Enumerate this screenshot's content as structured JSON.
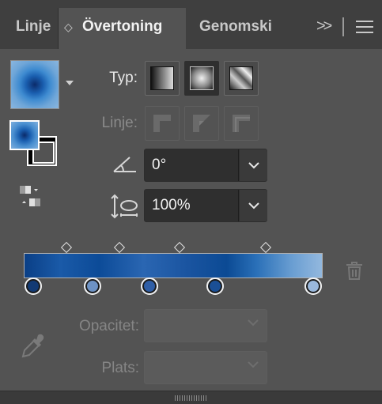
{
  "tabs": {
    "linje": "Linje",
    "overtoning": "Övertoning",
    "genomskinlighet": "Genomski",
    "more_icon": "double-chevron-right-icon",
    "menu_icon": "hamburger-menu-icon"
  },
  "labels": {
    "typ": "Typ:",
    "linje": "Linje:",
    "opacitet": "Opacitet:",
    "plats": "Plats:"
  },
  "angle": {
    "value": "0°"
  },
  "aspect": {
    "value": "100%"
  },
  "gradient": {
    "stops": [
      {
        "color": "#123a74",
        "location": 0.03
      },
      {
        "color": "#6d92c4",
        "location": 0.23
      },
      {
        "color": "#2f5ea6",
        "location": 0.42
      },
      {
        "color": "#1a4f96",
        "location": 0.64
      },
      {
        "color": "#9ab8dc",
        "location": 0.97
      }
    ],
    "midpoints": [
      0.14,
      0.32,
      0.52,
      0.81
    ]
  },
  "colors": {
    "panel": "#535353",
    "tabbar": "#3f3f3f",
    "field": "#2f2f2f"
  }
}
